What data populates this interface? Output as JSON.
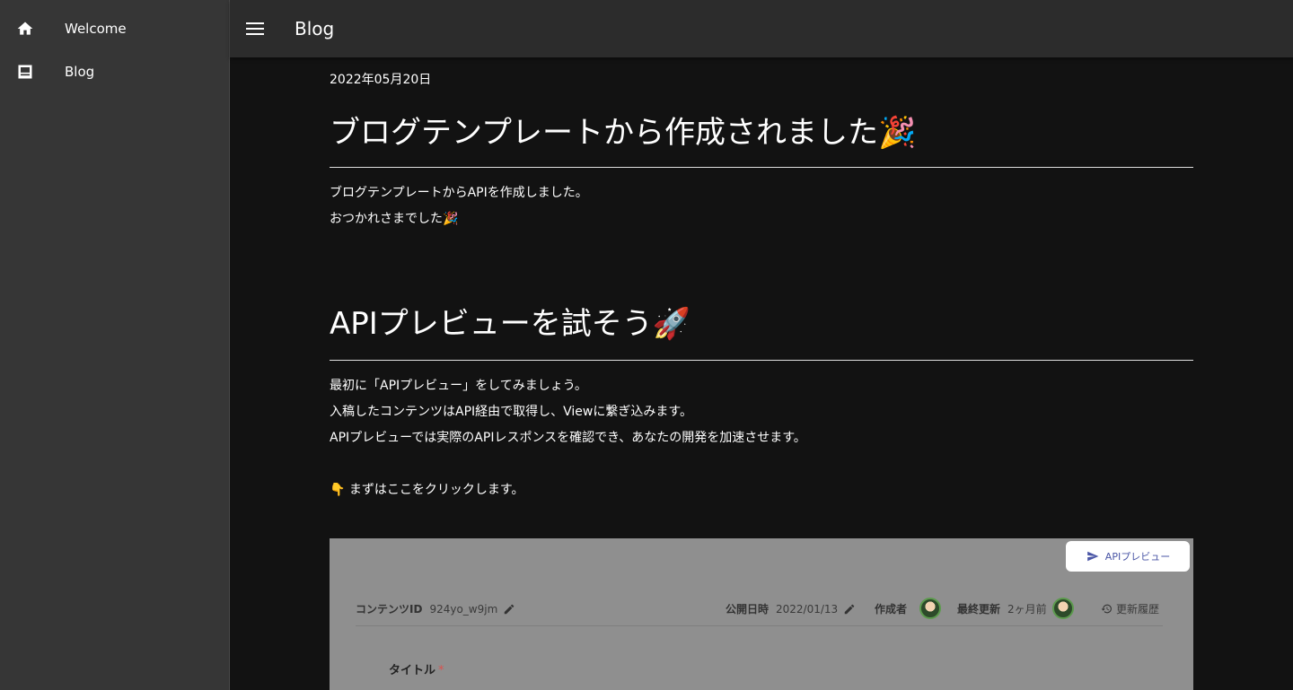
{
  "sidebar": {
    "items": [
      {
        "label": "Welcome",
        "icon": "home-icon"
      },
      {
        "label": "Blog",
        "icon": "blog-icon"
      }
    ]
  },
  "topbar": {
    "title": "Blog"
  },
  "post": {
    "date": "2022年05月20日",
    "title": "ブログテンプレートから作成されました🎉",
    "intro_line1": "ブログテンプレートからAPIを作成しました。",
    "intro_line2": "おつかれさまでした🎉",
    "section_title": "APIプレビューを試そう🚀",
    "body_line1": "最初に「APIプレビュー」をしてみましょう。",
    "body_line2": "入稿したコンテンツはAPI経由で取得し、Viewに繋ぎ込みます。",
    "body_line3": "APIプレビューでは実際のAPIレスポンスを確認でき、あなたの開発を加速させます。",
    "body_line4": "👇 まずはここをクリックします。"
  },
  "screenshot": {
    "preview_button": "APIプレビュー",
    "content_id_label": "コンテンツID",
    "content_id_value": "924yo_w9jm",
    "published_label": "公開日時",
    "published_value": "2022/01/13",
    "author_label": "作成者",
    "updated_label": "最終更新",
    "updated_value": "2ヶ月前",
    "history_label": "更新履歴",
    "title_label": "タイトル",
    "required_mark": "*"
  },
  "colors": {
    "background": "#121212",
    "sidebar": "#363636",
    "topbar": "#2c2c2c",
    "screenshot_bg": "#8f8f8f",
    "preview_button_text": "#4a56a6"
  }
}
